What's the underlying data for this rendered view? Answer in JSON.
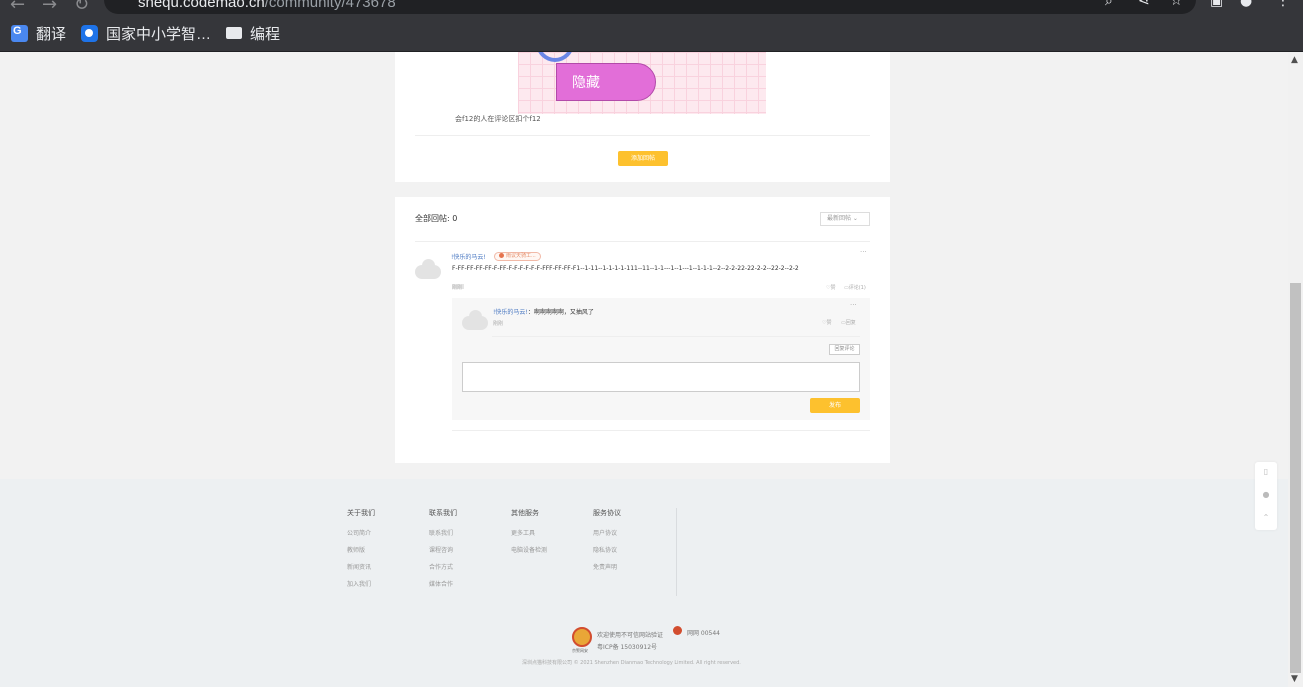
{
  "browser": {
    "url_host": "shequ.codemao.cn",
    "url_path": "/community/473678",
    "bookmarks": [
      {
        "label": "翻译",
        "icon": "translate-icon"
      },
      {
        "label": "国家中小学智…",
        "icon": "gov-site-icon"
      },
      {
        "label": "编程",
        "icon": "folder-icon"
      }
    ]
  },
  "post": {
    "code_block_label": "隐藏",
    "text": "会f12的人在评论区扣个f12",
    "add_reply_label": "添加回帖"
  },
  "replies": {
    "title": "全部回帖: 0",
    "sort_label": "最新回帖",
    "item": {
      "author": "!快乐的马云!",
      "badge": "雨议天骑工...",
      "content": "F-FF-FF-FF-FF-F-FF-F-F-F-F-F-F-FFF-FF-FF-F1--1-11--1-1-1-1-111--11--1-1---1--1---1--1-1-1--2--2-2-22-22-2-2--22-2--2-2",
      "time": "刚刚",
      "like_label": "赞",
      "comment_label": "评论(1)",
      "more": "···",
      "sub": {
        "author": "!快乐的马云!",
        "text": "啊啊啊啊啊，又抽风了",
        "time": "刚刚",
        "like_label": "赞",
        "reply_label": "回复",
        "more": "···",
        "reply_comment_label": "回复评论",
        "publish_label": "发布"
      }
    }
  },
  "footer": {
    "columns": [
      {
        "title": "关于我们",
        "items": [
          "公司简介",
          "教师版",
          "新闻资讯",
          "加入我们"
        ]
      },
      {
        "title": "联系我们",
        "items": [
          "联系我们",
          "课程咨询",
          "合作方式",
          "媒体合作"
        ]
      },
      {
        "title": "其他服务",
        "items": [
          "更多工具",
          "电脑设备检测"
        ]
      },
      {
        "title": "服务协议",
        "items": [
          "用户协议",
          "隐私协议",
          "免责声明"
        ]
      }
    ],
    "police_label": "京警网安",
    "license_text": "欢迎使用不可信网站验证",
    "icp": "粤ICP备 15030912号",
    "gongan": "网网 00544",
    "copyright": "深圳点猫科技有限公司   © 2021 Shenzhen Dianmao Technology Limited. All right reserved."
  },
  "colors": {
    "accent": "#fdc12e",
    "link": "#4a78c2",
    "chrome": "#35363a"
  }
}
